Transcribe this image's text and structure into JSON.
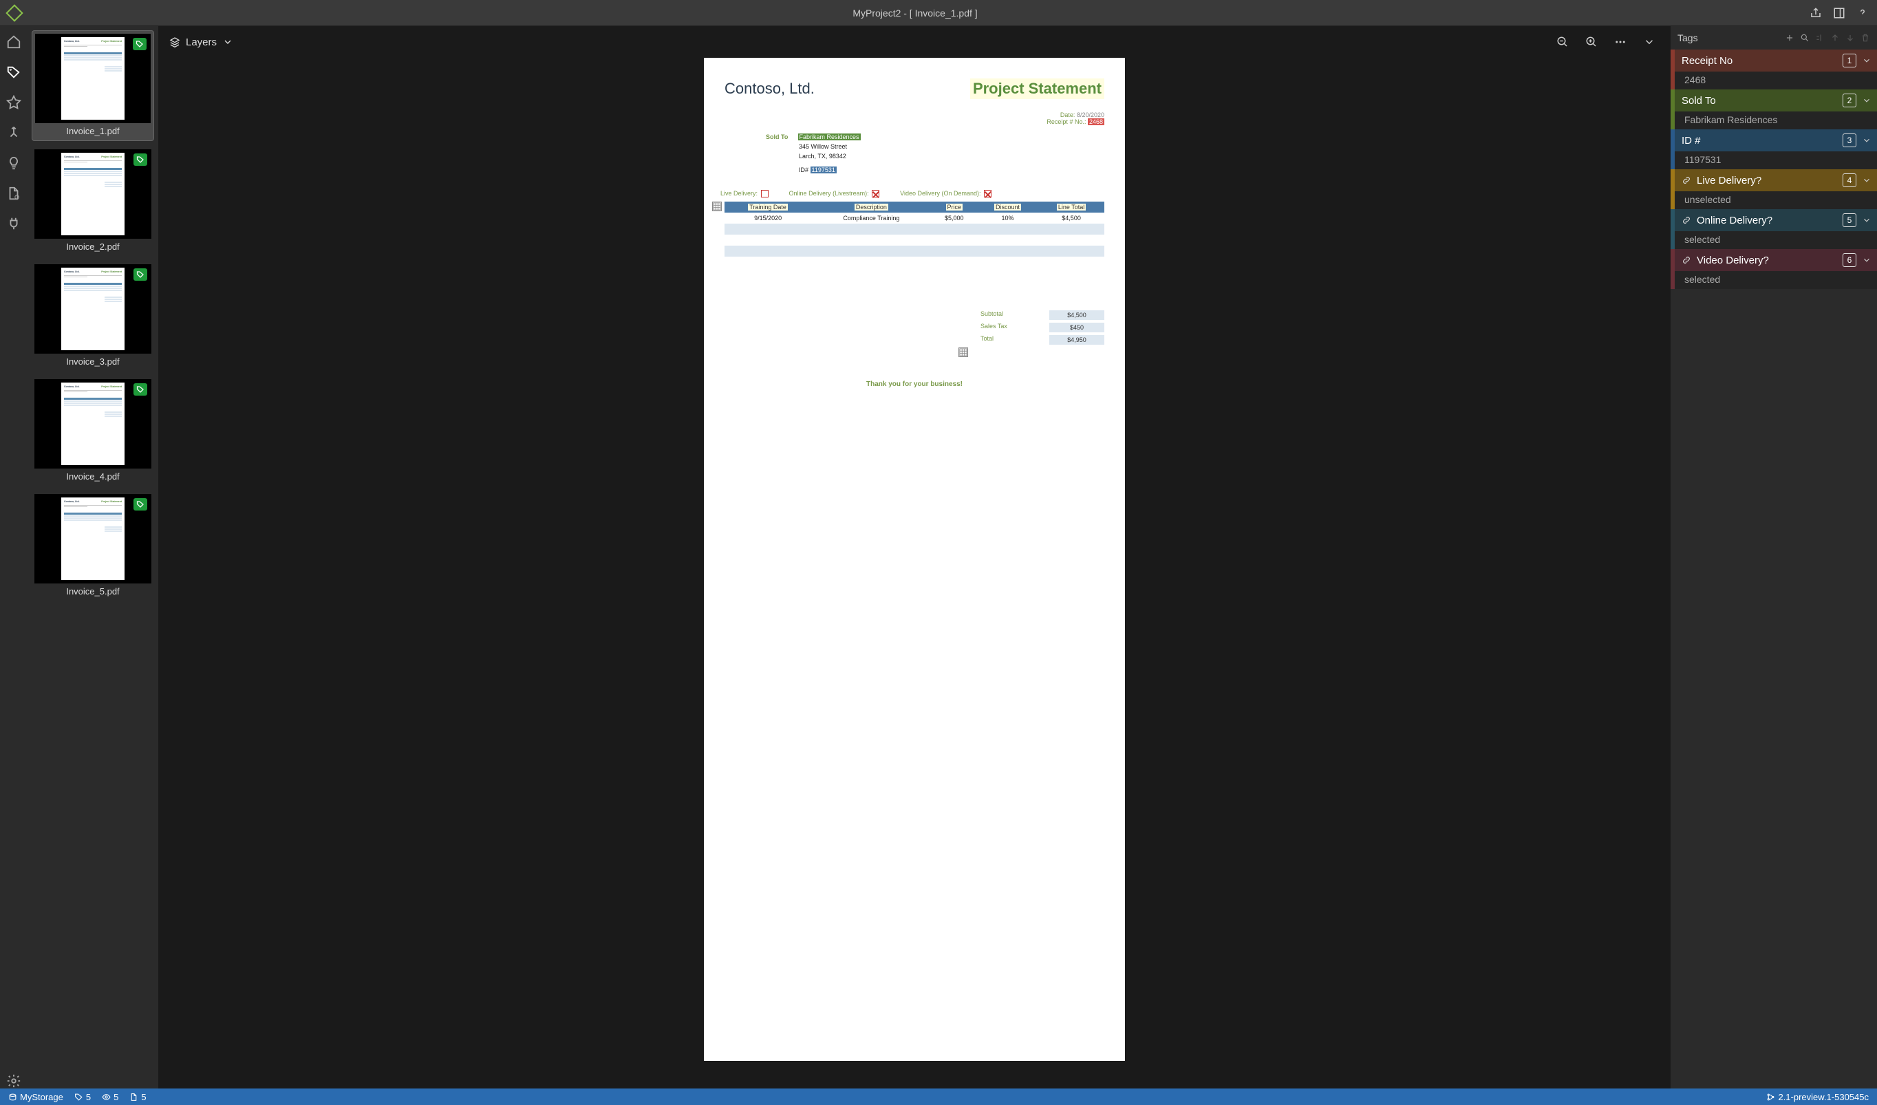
{
  "window_title": "MyProject2 - [ Invoice_1.pdf ]",
  "toolbar": {
    "layers_label": "Layers"
  },
  "thumbnails": {
    "items": [
      {
        "label": "Invoice_1.pdf"
      },
      {
        "label": "Invoice_2.pdf"
      },
      {
        "label": "Invoice_3.pdf"
      },
      {
        "label": "Invoice_4.pdf"
      },
      {
        "label": "Invoice_5.pdf"
      }
    ]
  },
  "document": {
    "company": "Contoso, Ltd.",
    "statement_title": "Project Statement",
    "date_label": "Date:",
    "date_value": "8/20/2020",
    "receipt_no_label": "Receipt # No.:",
    "receipt_no_value": "2468",
    "sold_to_label": "Sold To",
    "sold_to_name": "Fabrikam Residences",
    "sold_to_addr1": "345 Willow Street",
    "sold_to_addr2": "Larch, TX, 98342",
    "id_label": "ID#",
    "id_value": "1197531",
    "delivery": {
      "live_label": "Live Delivery:",
      "online_label": "Online Delivery (Livestream):",
      "video_label": "Video Delivery (On Demand):"
    },
    "table": {
      "headers": [
        "Training Date",
        "Description",
        "Price",
        "Discount",
        "Line Total"
      ],
      "rows": [
        [
          "9/15/2020",
          "Compliance Training",
          "$5,000",
          "10%",
          "$4,500"
        ]
      ]
    },
    "totals": {
      "subtotal_label": "Subtotal",
      "subtotal_value": "$4,500",
      "tax_label": "Sales Tax",
      "tax_value": "$450",
      "total_label": "Total",
      "total_value": "$4,950"
    },
    "thanks": "Thank you for your business!"
  },
  "tags_panel": {
    "title": "Tags",
    "items": [
      {
        "name": "Receipt No",
        "num": "1",
        "value": "2468",
        "color": "#8b3a2f",
        "bg": "#5a3028",
        "linked": false
      },
      {
        "name": "Sold To",
        "num": "2",
        "value": "Fabrikam Residences",
        "color": "#5a7a2a",
        "bg": "#3e5222",
        "linked": false
      },
      {
        "name": "ID #",
        "num": "3",
        "value": "1197531",
        "color": "#2a5a8a",
        "bg": "#24455e",
        "linked": false
      },
      {
        "name": "Live Delivery?",
        "num": "4",
        "value": "unselected",
        "color": "#a07818",
        "bg": "#6a5218",
        "linked": true
      },
      {
        "name": "Online Delivery?",
        "num": "5",
        "value": "selected",
        "color": "#2a5565",
        "bg": "#243e48",
        "linked": true
      },
      {
        "name": "Video Delivery?",
        "num": "6",
        "value": "selected",
        "color": "#6a3038",
        "bg": "#4a2830",
        "linked": true
      }
    ]
  },
  "statusbar": {
    "storage": "MyStorage",
    "tag_count": "5",
    "eye_count": "5",
    "doc_count": "5",
    "version": "2.1-preview.1-530545c"
  }
}
